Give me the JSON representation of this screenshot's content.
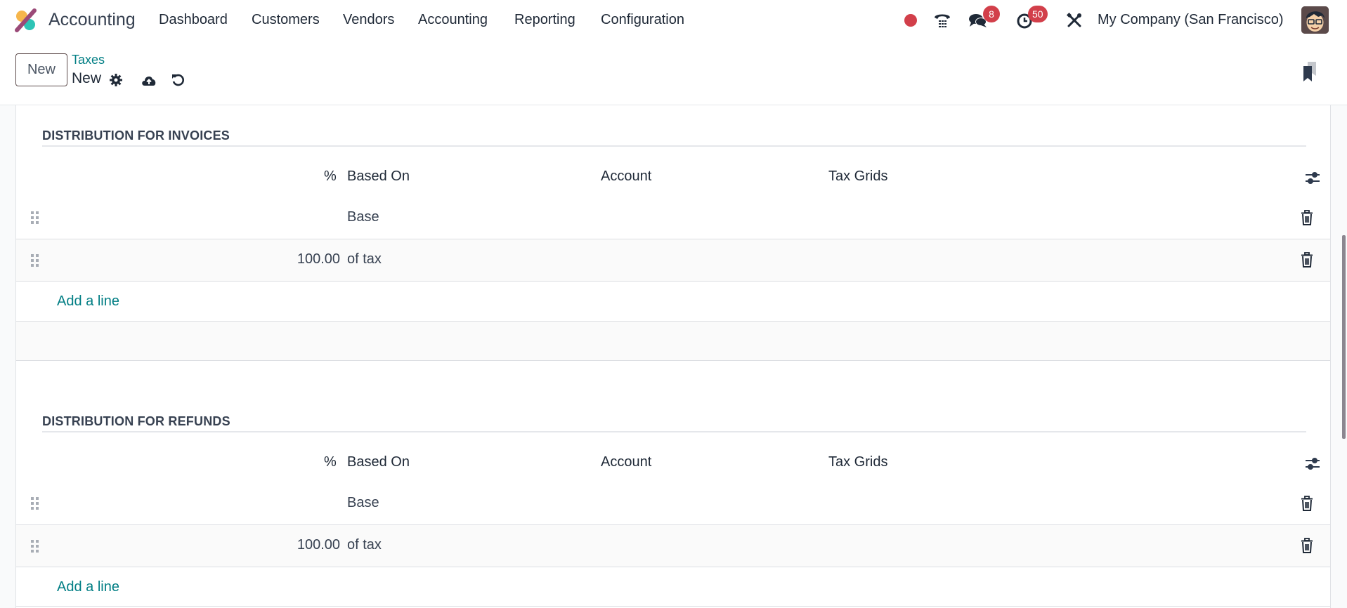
{
  "navbar": {
    "app_name": "Accounting",
    "menu": [
      "Dashboard",
      "Customers",
      "Vendors",
      "Accounting",
      "Reporting",
      "Configuration"
    ],
    "messages_badge": "8",
    "activities_badge": "50",
    "company": "My Company (San Francisco)",
    "icons": {
      "status": "recording-dot-icon",
      "phone": "phone-icon",
      "messages": "chat-icon",
      "activities": "clock-icon",
      "debug": "tools-icon"
    },
    "colors": {
      "badge": "#d23f4a",
      "status_dot": "#d23f4a"
    }
  },
  "control_panel": {
    "new_button": "New",
    "breadcrumb_parent": "Taxes",
    "breadcrumb_current": "New",
    "icons": [
      "gear-icon",
      "cloud-upload-icon",
      "undo-icon",
      "bookmark-icon"
    ]
  },
  "sections": [
    {
      "title": "DISTRIBUTION FOR INVOICES",
      "columns": {
        "percent": "%",
        "based_on": "Based On",
        "account": "Account",
        "tax_grids": "Tax Grids"
      },
      "rows": [
        {
          "percent": "",
          "based_on": "Base",
          "account": "",
          "tax_grids": ""
        },
        {
          "percent": "100.00",
          "based_on": "of tax",
          "account": "",
          "tax_grids": ""
        }
      ],
      "add_line": "Add a line"
    },
    {
      "title": "DISTRIBUTION FOR REFUNDS",
      "columns": {
        "percent": "%",
        "based_on": "Based On",
        "account": "Account",
        "tax_grids": "Tax Grids"
      },
      "rows": [
        {
          "percent": "",
          "based_on": "Base",
          "account": "",
          "tax_grids": ""
        },
        {
          "percent": "100.00",
          "based_on": "of tax",
          "account": "",
          "tax_grids": ""
        }
      ],
      "add_line": "Add a line"
    }
  ],
  "theme": {
    "link": "#017e84",
    "text": "#374151"
  }
}
